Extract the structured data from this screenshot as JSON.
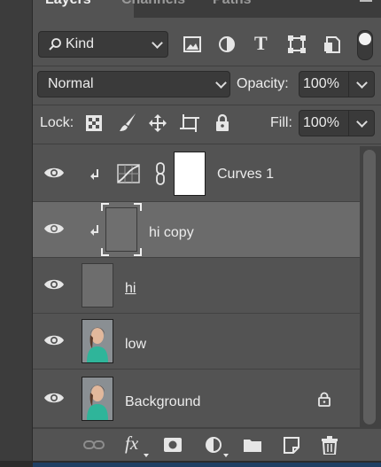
{
  "tabs": [
    {
      "label": "Layers"
    },
    {
      "label": "Channels"
    },
    {
      "label": "Paths"
    }
  ],
  "filter": {
    "selected": "Kind"
  },
  "blend_mode": {
    "selected": "Normal"
  },
  "opacity": {
    "label": "Opacity:",
    "value": "100%"
  },
  "lock": {
    "label": "Lock:"
  },
  "fill": {
    "label": "Fill:",
    "value": "100%"
  },
  "layers": [
    {
      "name": "Curves 1",
      "type": "adjustment",
      "clipped": true,
      "visible": true
    },
    {
      "name": "hi copy",
      "type": "pixel",
      "clipped": true,
      "visible": true,
      "selected": true
    },
    {
      "name": "hi",
      "type": "pixel",
      "clipped": false,
      "visible": true
    },
    {
      "name": "low",
      "type": "pixel",
      "clipped": false,
      "visible": true
    },
    {
      "name": "Background",
      "type": "pixel",
      "clipped": false,
      "visible": true,
      "locked": true
    }
  ],
  "colors": {
    "panel": "#535353",
    "selected_row": "#6b6b6b",
    "text": "#ececec"
  },
  "icons": {
    "footer": [
      "link-icon",
      "fx-icon",
      "mask-icon",
      "adjustment-icon",
      "folder-icon",
      "new-layer-icon",
      "trash-icon"
    ]
  }
}
